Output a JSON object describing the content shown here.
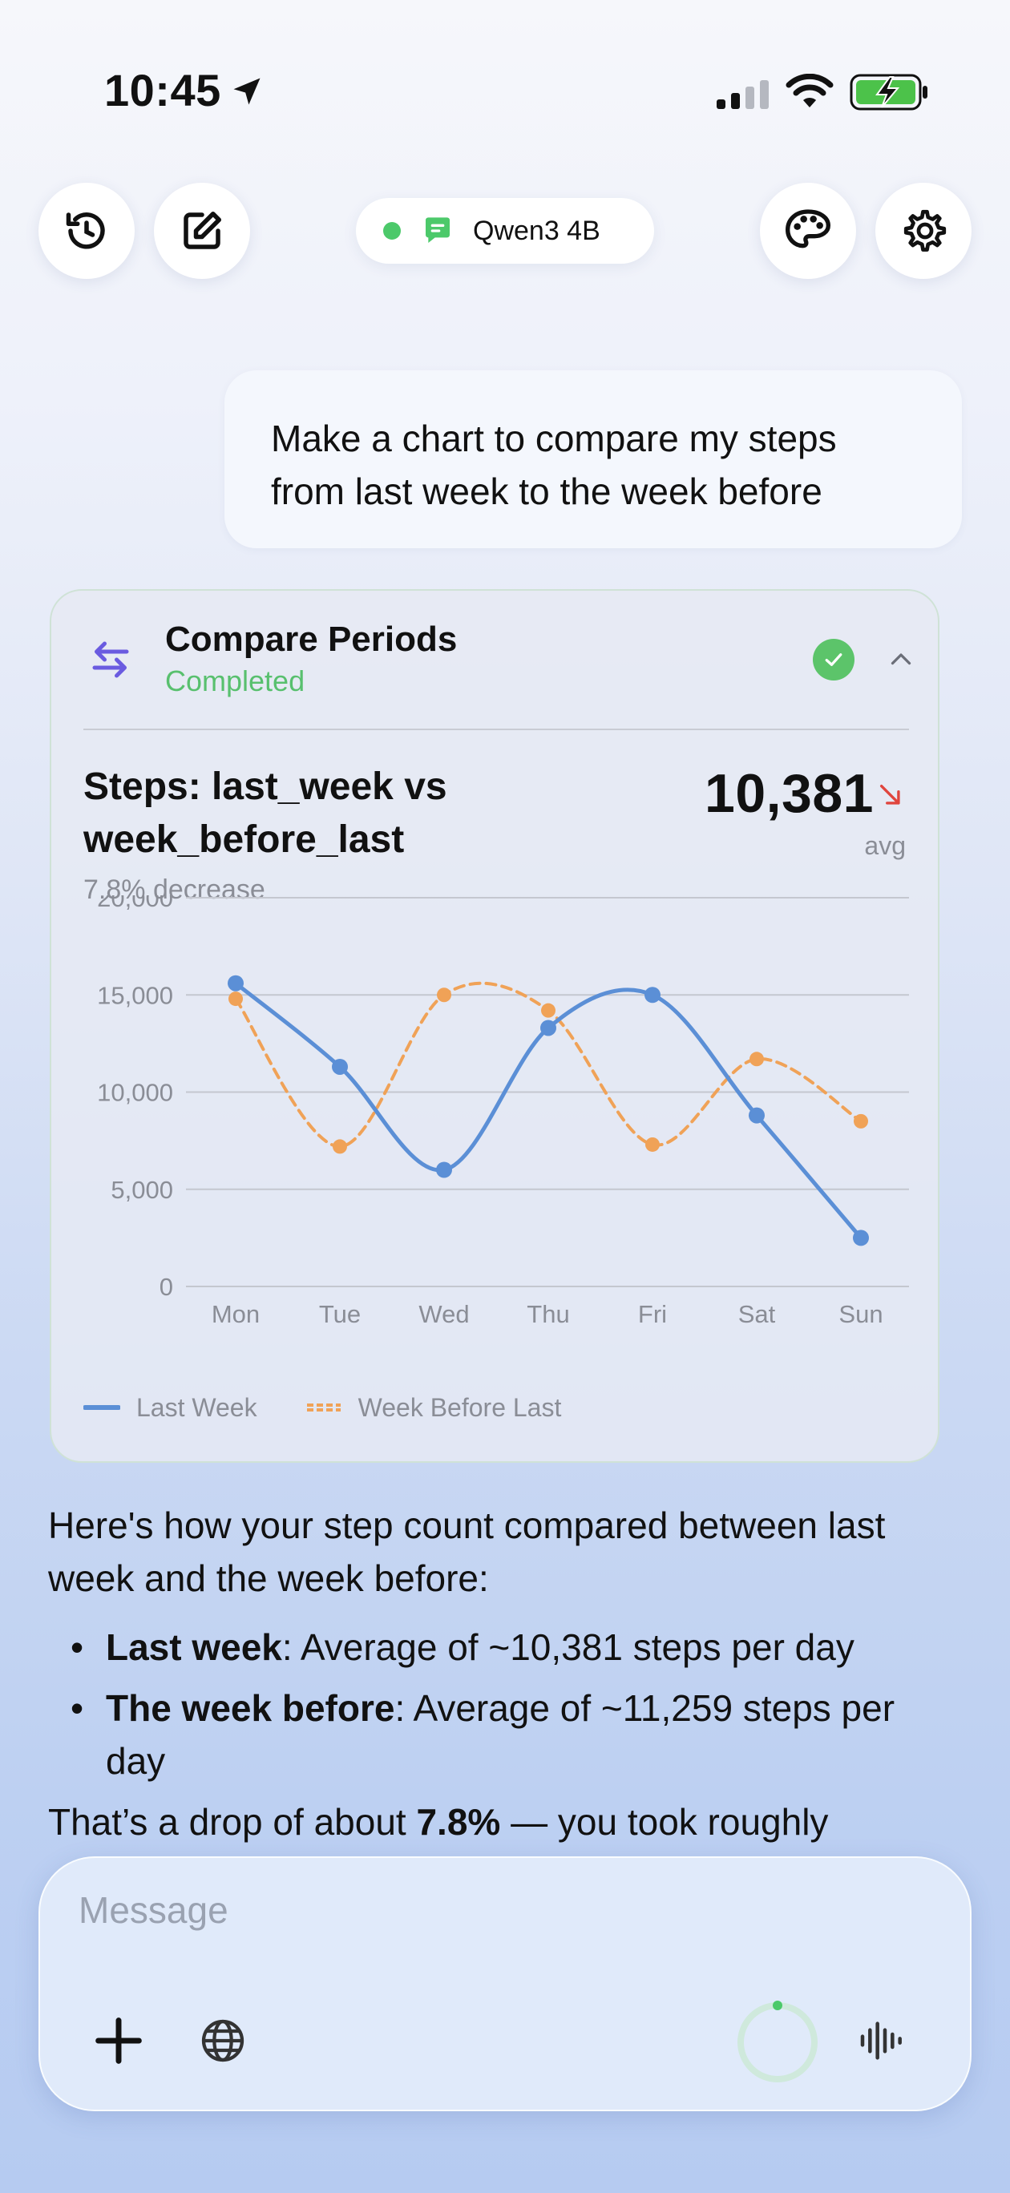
{
  "status_bar": {
    "time": "10:45"
  },
  "toolbar": {
    "model_name": "Qwen3 4B"
  },
  "user_message": "Make a chart to compare my steps from last week to the week before",
  "tool_card": {
    "title": "Compare Periods",
    "status": "Completed",
    "chart_title": "Steps: last_week vs week_before_last",
    "chart_subtitle": "7.8% decrease",
    "headline_value": "10,381",
    "headline_unit": "avg"
  },
  "chart_data": {
    "type": "line",
    "categories": [
      "Mon",
      "Tue",
      "Wed",
      "Thu",
      "Fri",
      "Sat",
      "Sun"
    ],
    "ylim": [
      0,
      20000
    ],
    "yticks": [
      "0",
      "5,000",
      "10,000",
      "15,000",
      "20,000"
    ],
    "ytick_values": [
      0,
      5000,
      10000,
      15000,
      20000
    ],
    "grid": true,
    "legend_position": "bottom-left",
    "series": [
      {
        "name": "Last Week",
        "values": [
          15600,
          11300,
          6000,
          13300,
          15000,
          8800,
          2500
        ],
        "color": "#5b8fd6",
        "style": "solid"
      },
      {
        "name": "Week Before Last",
        "values": [
          14800,
          7200,
          15000,
          14200,
          7300,
          11700,
          8500
        ],
        "color": "#f0a257",
        "style": "dashed"
      }
    ]
  },
  "assistant": {
    "intro": "Here's how your step count compared between last week and the week before:",
    "bullets": [
      {
        "bold": "Last week",
        "text": ": Average of ~10,381 steps per day"
      },
      {
        "bold": "The week before",
        "text": ": Average of ~11,259 steps per day"
      }
    ],
    "outro_start": "That’s a drop of about ",
    "outro_bold": "7.8%",
    "outro_end": " — you took roughly"
  },
  "composer": {
    "placeholder": "Message"
  },
  "colors": {
    "accent_green": "#58c06e",
    "accent_purple": "#6a5be0",
    "decrease_red": "#e0453d"
  }
}
